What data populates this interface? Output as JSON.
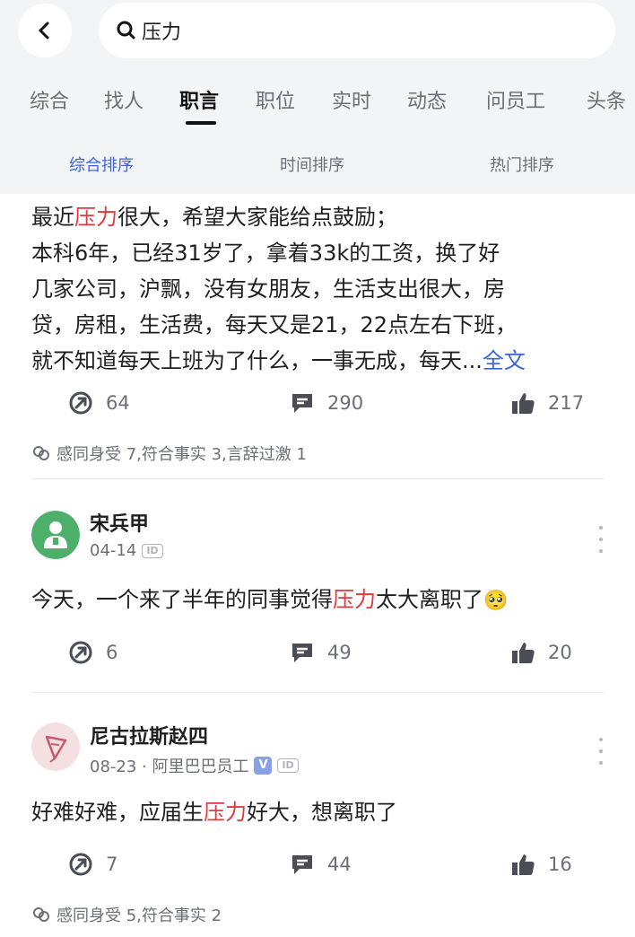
{
  "search": {
    "value": "压力",
    "icon": "search-icon"
  },
  "tabs": [
    "综合",
    "找人",
    "职言",
    "职位",
    "实时",
    "动态",
    "问员工",
    "头条"
  ],
  "active_tab": "职言",
  "sorts": [
    "综合排序",
    "时间排序",
    "热门排序"
  ],
  "active_sort": "综合排序",
  "colors": {
    "highlight": "#e0393e",
    "accent": "#3d63d8",
    "muted": "#6b6e75"
  },
  "post1": {
    "line1_pre": "最近",
    "line1_hl": "压力",
    "line1_post": "很大，希望大家能给点鼓励；",
    "line2": "本科6年，已经31岁了，拿着33k的工资，换了好",
    "line3": "几家公司，沪飘，没有女朋友，生活支出很大，房",
    "line4": "贷，房租，生活费，每天又是21，22点左右下班，",
    "line5": "就不知道每天上班为了什么，一事无成，每天...",
    "full_text_link": "全文",
    "shares": "64",
    "comments": "290",
    "likes": "217",
    "reactions": "感同身受 7,符合事实 3,言辞过激 1"
  },
  "post2": {
    "author": "宋兵甲",
    "date": "04-14",
    "id_badge": "ID",
    "text_pre": "今天，一个来了半年的同事觉得",
    "text_hl": "压力",
    "text_post": "太大离职了",
    "emoji": "🥺",
    "shares": "6",
    "comments": "49",
    "likes": "20"
  },
  "post3": {
    "author": "尼古拉斯赵四",
    "date_company": "08-23 · 阿里巴巴员工",
    "verified_badge": "V",
    "id_badge": "ID",
    "text_pre": "好难好难，应届生",
    "text_hl": "压力",
    "text_post": "好大，想离职了",
    "shares": "7",
    "comments": "44",
    "likes": "16",
    "reactions": "感同身受 5,符合事实 2"
  }
}
